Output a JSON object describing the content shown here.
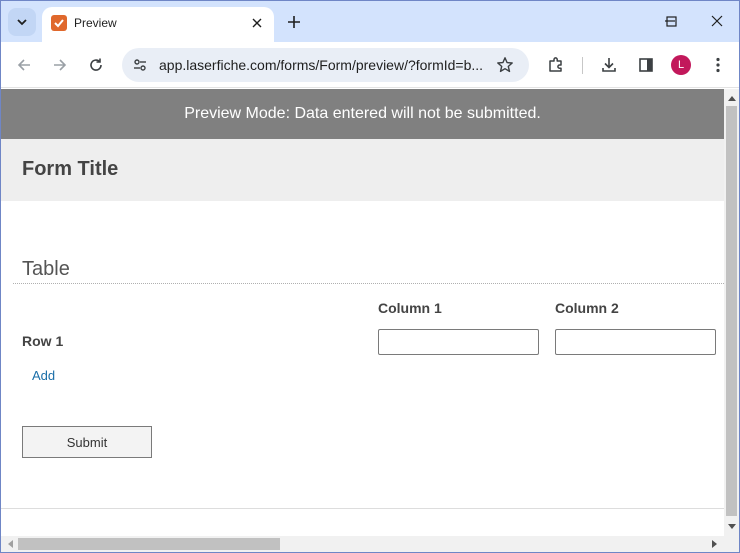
{
  "browser": {
    "tab_title": "Preview",
    "url": "app.laserfiche.com/forms/Form/preview/?formId=b...",
    "profile_initial": "L"
  },
  "form": {
    "banner": "Preview Mode: Data entered will not be submitted.",
    "title": "Form Title",
    "section_title": "Table",
    "columns": [
      "Column 1",
      "Column 2"
    ],
    "rows": [
      {
        "label": "Row 1",
        "values": [
          "",
          ""
        ]
      }
    ],
    "add_label": "Add",
    "submit_label": "Submit"
  },
  "colors": {
    "tabstrip": "#d3e3fd",
    "banner": "#808080",
    "header": "#eeeeee",
    "link": "#1a6ea8",
    "favicon": "#e0682c",
    "avatar": "#c2185b"
  }
}
